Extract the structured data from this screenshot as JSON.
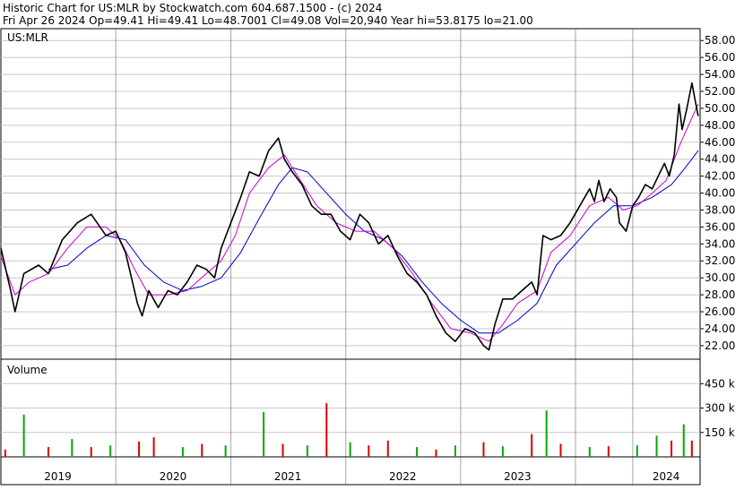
{
  "header": {
    "line1": "Historic Chart for US:MLR by Stockwatch.com 604.687.1500 - (c) 2024",
    "line2": "Fri Apr 26 2024   Op=49.41  Hi=49.41  Lo=48.7001  Cl=49.08  Vol=20,940  Year hi=53.8175  lo=21.00"
  },
  "chart_data": [
    {
      "type": "line",
      "title": "US:MLR",
      "series": [
        {
          "name": "",
          "color": "#000000",
          "values": [
            [
              "2019-01-01",
              33.5
            ],
            [
              "2019-02-01",
              28.5
            ],
            [
              "2019-02-15",
              26.0
            ],
            [
              "2019-03-15",
              30.5
            ],
            [
              "2019-05-01",
              31.5
            ],
            [
              "2019-06-01",
              30.5
            ],
            [
              "2019-07-15",
              34.5
            ],
            [
              "2019-09-01",
              36.5
            ],
            [
              "2019-10-15",
              37.5
            ],
            [
              "2019-12-01",
              35.0
            ],
            [
              "2020-01-01",
              35.5
            ],
            [
              "2020-02-01",
              33.0
            ],
            [
              "2020-02-20",
              30.0
            ],
            [
              "2020-03-10",
              27.0
            ],
            [
              "2020-03-25",
              25.5
            ],
            [
              "2020-04-15",
              28.5
            ],
            [
              "2020-05-15",
              26.5
            ],
            [
              "2020-06-15",
              28.5
            ],
            [
              "2020-07-15",
              28.0
            ],
            [
              "2020-08-15",
              29.5
            ],
            [
              "2020-09-15",
              31.5
            ],
            [
              "2020-10-15",
              31.0
            ],
            [
              "2020-11-10",
              30.0
            ],
            [
              "2020-12-01",
              33.5
            ],
            [
              "2021-01-01",
              36.5
            ],
            [
              "2021-02-01",
              39.5
            ],
            [
              "2021-03-01",
              42.5
            ],
            [
              "2021-04-01",
              42.0
            ],
            [
              "2021-05-01",
              45.0
            ],
            [
              "2021-06-01",
              46.5
            ],
            [
              "2021-06-20",
              44.0
            ],
            [
              "2021-07-15",
              42.5
            ],
            [
              "2021-08-15",
              41.0
            ],
            [
              "2021-09-15",
              38.5
            ],
            [
              "2021-10-15",
              37.5
            ],
            [
              "2021-11-15",
              37.5
            ],
            [
              "2021-12-15",
              35.5
            ],
            [
              "2022-01-15",
              34.5
            ],
            [
              "2022-02-15",
              37.5
            ],
            [
              "2022-03-15",
              36.5
            ],
            [
              "2022-04-15",
              34.0
            ],
            [
              "2022-05-15",
              35.0
            ],
            [
              "2022-06-15",
              32.5
            ],
            [
              "2022-07-15",
              30.5
            ],
            [
              "2022-08-15",
              29.5
            ],
            [
              "2022-09-15",
              28.0
            ],
            [
              "2022-10-15",
              25.5
            ],
            [
              "2022-11-15",
              23.5
            ],
            [
              "2022-12-15",
              22.5
            ],
            [
              "2023-01-15",
              24.0
            ],
            [
              "2023-02-15",
              23.5
            ],
            [
              "2023-03-15",
              22.0
            ],
            [
              "2023-04-01",
              21.5
            ],
            [
              "2023-04-20",
              24.5
            ],
            [
              "2023-05-15",
              27.5
            ],
            [
              "2023-06-15",
              27.5
            ],
            [
              "2023-07-15",
              28.5
            ],
            [
              "2023-08-15",
              29.5
            ],
            [
              "2023-09-01",
              28.0
            ],
            [
              "2023-09-20",
              35.0
            ],
            [
              "2023-10-15",
              34.5
            ],
            [
              "2023-11-15",
              35.0
            ],
            [
              "2023-12-15",
              36.5
            ],
            [
              "2024-01-15",
              38.5
            ],
            [
              "2024-02-15",
              40.5
            ],
            [
              "2024-03-01",
              39.0
            ],
            [
              "2024-03-15",
              41.5
            ],
            [
              "2024-04-01",
              39.0
            ],
            [
              "2024-04-20",
              40.5
            ],
            [
              "2024-05-10",
              39.5
            ],
            [
              "2024-05-20",
              36.5
            ],
            [
              "2024-06-10",
              35.5
            ],
            [
              "2024-07-01",
              38.5
            ],
            [
              "2024-07-20",
              39.5
            ],
            [
              "2024-08-10",
              41.0
            ],
            [
              "2024-09-01",
              40.5
            ],
            [
              "2024-09-20",
              42.0
            ],
            [
              "2024-10-10",
              43.5
            ],
            [
              "2024-10-25",
              42.0
            ],
            [
              "2024-11-10",
              44.5
            ],
            [
              "2024-11-25",
              50.5
            ],
            [
              "2024-12-05",
              47.5
            ],
            [
              "2024-12-20",
              50.0
            ],
            [
              "2025-01-05",
              53.0
            ],
            [
              "2025-01-15",
              51.0
            ],
            [
              "2025-01-25",
              49.08
            ]
          ]
        },
        {
          "name": "",
          "color": "#cc00cc",
          "values": [
            [
              "2019-01-01",
              32.5
            ],
            [
              "2019-02-15",
              28.0
            ],
            [
              "2019-04-01",
              29.5
            ],
            [
              "2019-06-01",
              30.5
            ],
            [
              "2019-08-01",
              33.5
            ],
            [
              "2019-10-01",
              36.0
            ],
            [
              "2019-12-01",
              36.0
            ],
            [
              "2020-01-15",
              34.5
            ],
            [
              "2020-03-01",
              31.0
            ],
            [
              "2020-04-15",
              28.0
            ],
            [
              "2020-06-15",
              28.0
            ],
            [
              "2020-08-15",
              28.5
            ],
            [
              "2020-10-15",
              30.5
            ],
            [
              "2020-12-01",
              32.0
            ],
            [
              "2021-01-15",
              35.0
            ],
            [
              "2021-03-01",
              40.0
            ],
            [
              "2021-05-01",
              43.0
            ],
            [
              "2021-06-20",
              44.5
            ],
            [
              "2021-08-01",
              42.0
            ],
            [
              "2021-10-01",
              38.5
            ],
            [
              "2021-12-01",
              36.5
            ],
            [
              "2022-02-01",
              35.5
            ],
            [
              "2022-04-01",
              35.5
            ],
            [
              "2022-06-01",
              33.5
            ],
            [
              "2022-08-01",
              30.5
            ],
            [
              "2022-10-01",
              27.0
            ],
            [
              "2022-12-01",
              24.0
            ],
            [
              "2023-02-01",
              23.5
            ],
            [
              "2023-04-01",
              22.5
            ],
            [
              "2023-05-15",
              24.5
            ],
            [
              "2023-07-01",
              27.0
            ],
            [
              "2023-09-01",
              28.5
            ],
            [
              "2023-10-15",
              33.0
            ],
            [
              "2023-12-15",
              35.0
            ],
            [
              "2024-02-15",
              38.5
            ],
            [
              "2024-04-15",
              39.5
            ],
            [
              "2024-06-01",
              38.0
            ],
            [
              "2024-07-15",
              38.5
            ],
            [
              "2024-09-01",
              40.0
            ],
            [
              "2024-10-15",
              41.5
            ],
            [
              "2024-12-01",
              46.0
            ],
            [
              "2025-01-25",
              50.5
            ]
          ]
        },
        {
          "name": "",
          "color": "#0000cc",
          "values": [
            [
              "2019-06-01",
              31.0
            ],
            [
              "2019-08-01",
              31.5
            ],
            [
              "2019-10-01",
              33.5
            ],
            [
              "2019-12-01",
              35.0
            ],
            [
              "2020-02-01",
              34.5
            ],
            [
              "2020-04-01",
              31.5
            ],
            [
              "2020-06-01",
              29.5
            ],
            [
              "2020-08-01",
              28.5
            ],
            [
              "2020-10-01",
              29.0
            ],
            [
              "2020-12-01",
              30.0
            ],
            [
              "2021-02-01",
              33.0
            ],
            [
              "2021-04-01",
              37.0
            ],
            [
              "2021-06-01",
              41.0
            ],
            [
              "2021-07-15",
              43.0
            ],
            [
              "2021-09-01",
              42.5
            ],
            [
              "2021-11-01",
              40.0
            ],
            [
              "2022-01-01",
              37.5
            ],
            [
              "2022-03-01",
              35.5
            ],
            [
              "2022-05-01",
              34.5
            ],
            [
              "2022-07-01",
              32.5
            ],
            [
              "2022-09-01",
              29.5
            ],
            [
              "2022-11-01",
              27.0
            ],
            [
              "2023-01-01",
              25.0
            ],
            [
              "2023-03-01",
              23.5
            ],
            [
              "2023-05-01",
              23.5
            ],
            [
              "2023-07-01",
              25.0
            ],
            [
              "2023-09-01",
              27.0
            ],
            [
              "2023-11-01",
              31.5
            ],
            [
              "2024-01-01",
              34.0
            ],
            [
              "2024-03-01",
              36.5
            ],
            [
              "2024-05-01",
              38.5
            ],
            [
              "2024-07-01",
              38.5
            ],
            [
              "2024-09-01",
              39.5
            ],
            [
              "2024-11-01",
              41.0
            ],
            [
              "2024-12-15",
              43.0
            ],
            [
              "2025-01-25",
              45.0
            ]
          ]
        }
      ],
      "y_ticks": [
        "58.00",
        "56.00",
        "54.00",
        "52.00",
        "50.00",
        "48.00",
        "46.00",
        "44.00",
        "42.00",
        "40.00",
        "38.00",
        "36.00",
        "34.00",
        "32.00",
        "30.00",
        "28.00",
        "26.00",
        "24.00",
        "22.00"
      ],
      "ylim": [
        20.4,
        59.4
      ],
      "grid": true,
      "xlabel": "",
      "ylabel": ""
    },
    {
      "type": "bar",
      "title": "Volume",
      "y_ticks": [
        "450 k",
        "300 k",
        "150 k"
      ],
      "ylim": [
        0,
        600000
      ],
      "bar_colors": {
        "up": "#00aa00",
        "down": "#dd0000"
      },
      "values": [
        [
          "2019-01-15",
          45000,
          "down"
        ],
        [
          "2019-03-15",
          260000,
          "up"
        ],
        [
          "2019-06-01",
          60000,
          "down"
        ],
        [
          "2019-08-15",
          110000,
          "up"
        ],
        [
          "2019-10-15",
          60000,
          "down"
        ],
        [
          "2019-12-15",
          70000,
          "up"
        ],
        [
          "2020-03-15",
          95000,
          "down"
        ],
        [
          "2020-05-01",
          120000,
          "down"
        ],
        [
          "2020-08-01",
          60000,
          "up"
        ],
        [
          "2020-10-01",
          80000,
          "down"
        ],
        [
          "2020-12-15",
          70000,
          "up"
        ],
        [
          "2021-04-15",
          275000,
          "up"
        ],
        [
          "2021-06-15",
          80000,
          "down"
        ],
        [
          "2021-09-01",
          70000,
          "up"
        ],
        [
          "2021-11-01",
          330000,
          "down"
        ],
        [
          "2022-01-15",
          90000,
          "up"
        ],
        [
          "2022-03-15",
          70000,
          "down"
        ],
        [
          "2022-05-15",
          100000,
          "down"
        ],
        [
          "2022-08-15",
          60000,
          "up"
        ],
        [
          "2022-10-15",
          45000,
          "down"
        ],
        [
          "2022-12-15",
          70000,
          "up"
        ],
        [
          "2023-03-15",
          90000,
          "down"
        ],
        [
          "2023-05-15",
          65000,
          "up"
        ],
        [
          "2023-08-15",
          140000,
          "down"
        ],
        [
          "2023-10-01",
          285000,
          "up"
        ],
        [
          "2023-11-15",
          80000,
          "down"
        ],
        [
          "2024-02-15",
          60000,
          "up"
        ],
        [
          "2024-04-15",
          65000,
          "down"
        ],
        [
          "2024-07-15",
          70000,
          "up"
        ],
        [
          "2024-09-15",
          130000,
          "up"
        ],
        [
          "2024-11-01",
          100000,
          "down"
        ],
        [
          "2024-12-10",
          200000,
          "up"
        ],
        [
          "2025-01-05",
          100000,
          "down"
        ]
      ]
    }
  ],
  "x_axis": {
    "labels": [
      {
        "date": "2019-07-01",
        "text": "2019"
      },
      {
        "date": "2020-07-01",
        "text": "2020"
      },
      {
        "date": "2021-07-01",
        "text": "2021"
      },
      {
        "date": "2022-07-01",
        "text": "2022"
      },
      {
        "date": "2023-07-01",
        "text": "2023"
      },
      {
        "date": "2024-10-15",
        "text": "2024"
      }
    ],
    "year_dividers": [
      "2020-01-01",
      "2021-01-01",
      "2022-01-01",
      "2023-01-01",
      "2024-01-01",
      "2024-07-01"
    ],
    "start": "2019-01-01",
    "end": "2025-01-31"
  }
}
